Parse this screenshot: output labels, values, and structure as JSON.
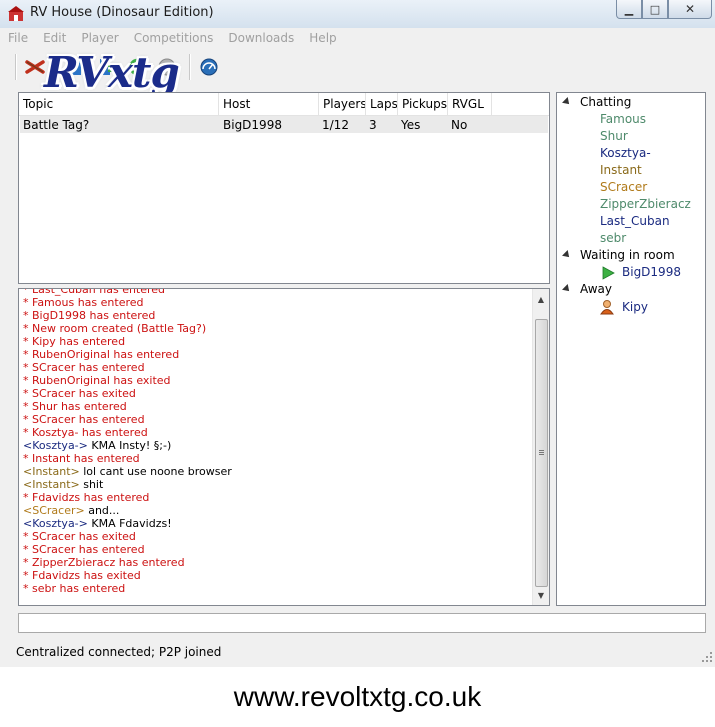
{
  "window": {
    "title": "RV House (Dinosaur Edition)"
  },
  "menu": [
    "File",
    "Edit",
    "Player",
    "Competitions",
    "Downloads",
    "Help"
  ],
  "logo_text": "RVxtg",
  "rooms": {
    "columns": [
      "Topic",
      "Host",
      "Players",
      "Laps",
      "Pickups",
      "RVGL"
    ],
    "rows": [
      {
        "topic": "Battle Tag?",
        "host": "BigD1998",
        "players": "1/12",
        "laps": "3",
        "pickups": "Yes",
        "rvgl": "No"
      }
    ]
  },
  "users": {
    "groups": [
      {
        "label": "Chatting",
        "members": [
          {
            "name": "Famous",
            "color": "#4e8a6b"
          },
          {
            "name": "Shur",
            "color": "#4e8a6b"
          },
          {
            "name": "Kosztya-",
            "color": "#1a2a80"
          },
          {
            "name": "Instant",
            "color": "#8a6a1a"
          },
          {
            "name": "SCracer",
            "color": "#b07a1a"
          },
          {
            "name": "ZipperZbieracz",
            "color": "#4e8a6b"
          },
          {
            "name": "Last_Cuban",
            "color": "#1a2a80"
          },
          {
            "name": "sebr",
            "color": "#4e8a6b"
          }
        ]
      },
      {
        "label": "Waiting in room",
        "members": [
          {
            "name": "BigD1998",
            "color": "#1a2a80",
            "icon": "play-icon"
          }
        ]
      },
      {
        "label": "Away",
        "members": [
          {
            "name": "Kipy",
            "color": "#1a2a80",
            "icon": "away-user-icon"
          }
        ]
      }
    ]
  },
  "chat": {
    "colors": {
      "system": "#cc1111",
      "Kosztya-": "#1a2a80",
      "Instant": "#8a6a1a",
      "SCracer": "#b07a1a"
    },
    "lines": [
      {
        "type": "sys",
        "text": "* Last_Cuban has entered"
      },
      {
        "type": "sys",
        "text": "* Famous has entered"
      },
      {
        "type": "sys",
        "text": "* BigD1998 has entered"
      },
      {
        "type": "sys",
        "text": "* New room created (Battle Tag?)"
      },
      {
        "type": "sys",
        "text": "* Kipy has entered"
      },
      {
        "type": "sys",
        "text": "* RubenOriginal has entered"
      },
      {
        "type": "sys",
        "text": "* SCracer has entered"
      },
      {
        "type": "sys",
        "text": "* RubenOriginal has exited"
      },
      {
        "type": "sys",
        "text": "* SCracer has exited"
      },
      {
        "type": "sys",
        "text": "* Shur has entered"
      },
      {
        "type": "sys",
        "text": "* SCracer has entered"
      },
      {
        "type": "sys",
        "text": "* Kosztya- has entered"
      },
      {
        "type": "msg",
        "user": "Kosztya-",
        "text": " KMA Insty! §;-)"
      },
      {
        "type": "sys",
        "text": "* Instant has entered"
      },
      {
        "type": "msg",
        "user": "Instant",
        "text": " lol cant use noone browser"
      },
      {
        "type": "msg",
        "user": "Instant",
        "text": " shit"
      },
      {
        "type": "sys",
        "text": "* Fdavidzs has entered"
      },
      {
        "type": "msg",
        "user": "SCracer",
        "text": " and..."
      },
      {
        "type": "msg",
        "user": "Kosztya-",
        "text": " KMA Fdavidzs!"
      },
      {
        "type": "sys",
        "text": "* SCracer has exited"
      },
      {
        "type": "sys",
        "text": "* SCracer has entered"
      },
      {
        "type": "sys",
        "text": "* ZipperZbieracz has entered"
      },
      {
        "type": "sys",
        "text": "* Fdavidzs has exited"
      },
      {
        "type": "sys",
        "text": "* sebr has entered"
      }
    ]
  },
  "status": "Centralized connected; P2P joined",
  "footer": "www.revoltxtg.co.uk"
}
